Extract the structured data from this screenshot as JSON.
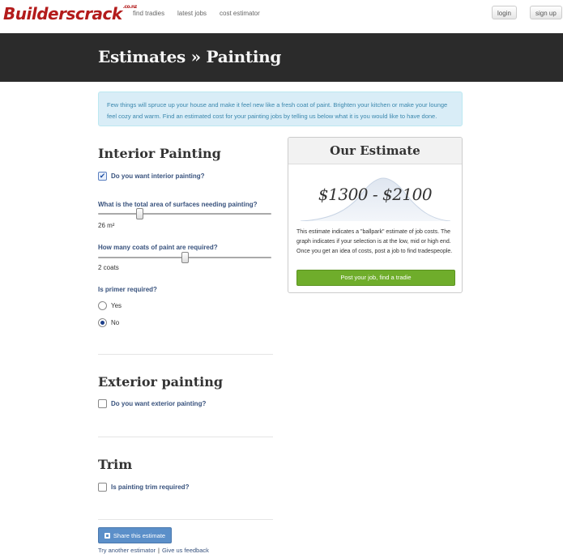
{
  "nav": {
    "logo": "Builderscrack",
    "logo_tld": ".co.nz",
    "links": [
      "find tradies",
      "latest jobs",
      "cost estimator"
    ],
    "login": "login",
    "signup": "sign up"
  },
  "header": {
    "title": "Estimates » Painting"
  },
  "intro": "Few things will spruce up your house and make it feel new like a fresh coat of paint. Brighten your kitchen or make your lounge feel cozy and warm. Find an estimated cost for your painting jobs by telling us below what it is you would like to have done.",
  "interior": {
    "title": "Interior Painting",
    "checkbox_label": "Do you want interior painting?",
    "checked": true,
    "area_question": "What is the total area of surfaces needing painting?",
    "area_value": "26 m²",
    "area_level": 0.24,
    "coats_question": "How many coats of paint are required?",
    "coats_value": "2 coats",
    "coats_level": 0.5,
    "primer_question": "Is primer required?",
    "primer_options": [
      "Yes",
      "No"
    ],
    "primer_selected": "No"
  },
  "exterior": {
    "title": "Exterior painting",
    "checkbox_label": "Do you want exterior painting?",
    "checked": false
  },
  "trim": {
    "title": "Trim",
    "checkbox_label": "Is painting trim required?",
    "checked": false
  },
  "estimate": {
    "title": "Our Estimate",
    "price": "$1300 - $2100",
    "description": "This estimate indicates a \"ballpark\" estimate of job costs. The graph indicates if your selection is at the low, mid or high end. Once you get an idea of costs, post a job to find tradespeople.",
    "button": "Post your job, find a tradie",
    "button_color": "#6fad2b"
  },
  "footer": {
    "share_button": "Share this estimate",
    "link_try": "Try another estimator",
    "link_feedback": "Give us feedback"
  }
}
